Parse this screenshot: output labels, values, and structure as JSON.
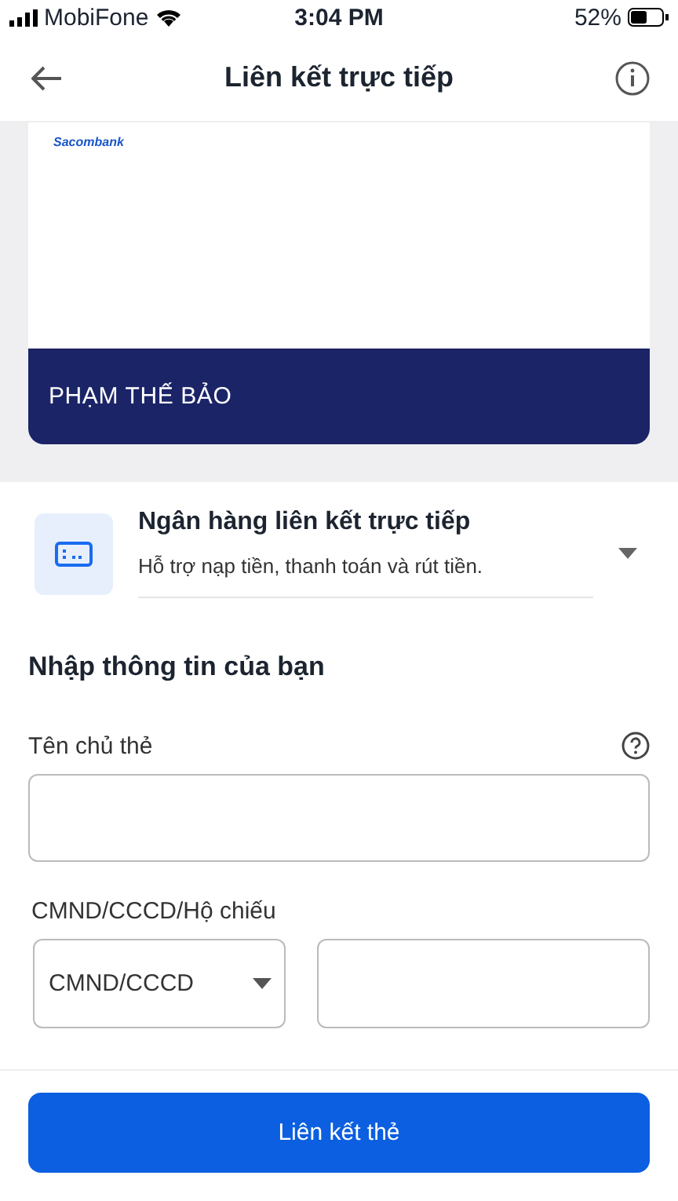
{
  "status_bar": {
    "carrier": "MobiFone",
    "time": "3:04 PM",
    "battery": "52%"
  },
  "header": {
    "title": "Liên kết trực tiếp"
  },
  "card": {
    "bank": "Sacombank",
    "holder": "PHẠM THẾ BẢO"
  },
  "link_method": {
    "title": "Ngân hàng liên kết trực tiếp",
    "subtitle": "Hỗ trợ nạp tiền, thanh toán và rút tiền.",
    "expanded": false
  },
  "form": {
    "title": "Nhập thông tin của bạn",
    "fields": [
      {
        "kind": "text",
        "label": "Tên chủ thẻ",
        "help": true
      },
      {
        "kind": "id",
        "label": "CMND/CCCD/Hộ chiếu",
        "id_type": "CMND/CCCD"
      }
    ]
  },
  "submit_button": "Liên kết thẻ"
}
